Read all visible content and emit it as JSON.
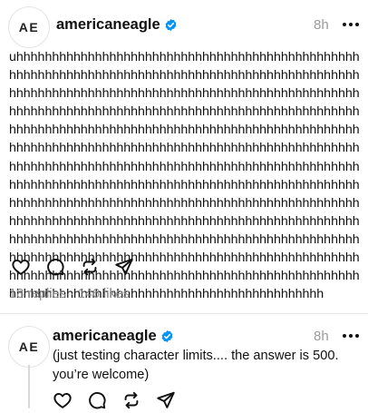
{
  "post": {
    "avatar_initials": "AE",
    "username": "americaneagle",
    "time": "8h",
    "text": "uhhhhhhhhhhhhhhhhhhhhhhhhhhhhhhhhhhhhhhhhhhhhhhhhhhhhhhhhhhhhhhhhhhhhhhhhhhhhhhhhhhhhhhhhhhhhhhhhhhhhhhhhhhhhhhhhhhhhhhhhhhhhhhhhhhhhhhhhhhhhhhhhhhhhhhhhhhhhhhhhhhhhhhhhhhhhhhhhhhhhhhhhhhhhhhhhhhhhhhhhhhhhhhhhhhhhhhhhhhhhhhhhhhhhhhhhhhhhhhhhhhhhhhhhhhhhhhhhhhhhhhhhhhhhhhhhhhhhhhhhhhhhhhhhhhhhhhhhhhhhhhhhhhhhhhhhhhhhhhhhhhhhhhhhhhhhhhhhhhhhhhhhhhhhhhhhhhhhhhhhhhhhhhhhhhhhhhhhhhhhhhhhhhhhhhhhhhhhhhhhhhhhhhhhhhhhhhhhhhhhhhhhhhhhhhhhhhhhhhhhhhhhhhhhhhhhhhhhhhhhhhhhhhhhhhhhhhhhhhhhhhhhhhhhhhhhhhhhhhhhhhhhhhhhhhhhhhhhhhhhhhhhhhhhhhhhhhhhhhhhhhhhhhhhhhhhhhhhhhhhhhhhhhhhhhhhhhhhhhhhhhhhhhhhhhhhhhhhhhhhhhhhhhhhhhhhhhhhhhhhhhhhhhhhhhhhhhhhhhhhhhhhhhhhhhhhhhhhhhhhhhhhhhhhhhhhhhhhhhhh",
    "stats": "18 replies · 146 likes",
    "icons": [
      "heart-icon",
      "comment-icon",
      "repost-icon",
      "share-icon"
    ]
  },
  "reply": {
    "avatar_initials": "AE",
    "username": "americaneagle",
    "time": "8h",
    "text": "(just testing character limits.... the answer is 500. you’re welcome)",
    "icons": [
      "heart-icon",
      "comment-icon",
      "repost-icon",
      "share-icon"
    ]
  },
  "colors": {
    "verified_badge": "#0095f6",
    "muted_text": "#8e8e8e",
    "primary_text": "#111111"
  }
}
